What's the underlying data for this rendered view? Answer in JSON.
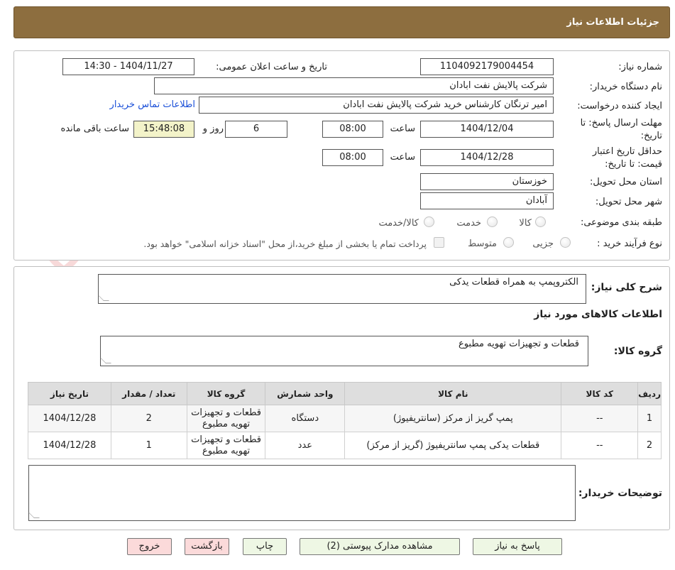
{
  "header": {
    "title": "جزئیات اطلاعات نیاز"
  },
  "form": {
    "need_number_label": "شماره نیاز:",
    "need_number": "1104092179004454",
    "announce_label": "تاریخ و ساعت اعلان عمومی:",
    "announce_value": "1404/11/27 - 14:30",
    "buyer_org_label": "نام دستگاه خریدار:",
    "buyer_org": "شرکت پالایش نفت ابادان",
    "creator_label": "ایجاد کننده درخواست:",
    "creator": "امیر ترنگان کارشناس خرید شرکت پالایش نفت ابادان",
    "contact_link": "اطلاعات تماس خریدار",
    "deadline_label_1": "مهلت ارسال پاسخ: تا",
    "deadline_label_2": "تاریخ:",
    "deadline_date": "1404/12/04",
    "time_label": "ساعت",
    "deadline_time": "08:00",
    "days_value": "6",
    "days_label": "روز و",
    "remaining_time": "15:48:08",
    "remaining_label": "ساعت باقی مانده",
    "validity_label_1": "حداقل تاریخ اعتبار",
    "validity_label_2": "قیمت: تا تاریخ:",
    "validity_date": "1404/12/28",
    "validity_time": "08:00",
    "province_label": "استان محل تحویل:",
    "province": "خوزستان",
    "city_label": "شهر محل تحویل:",
    "city": "آبادان",
    "category_label": "طبقه بندی موضوعی:",
    "category_options": [
      "کالا",
      "خدمت",
      "کالا/خدمت"
    ],
    "process_label": "نوع فرآیند خرید :",
    "process_options": [
      "جزیی",
      "متوسط"
    ],
    "payment_note": "پرداخت تمام یا بخشی از مبلغ خرید،از محل \"اسناد خزانه اسلامی\" خواهد بود."
  },
  "details": {
    "summary_label": "شرح کلی نیاز:",
    "summary": "الکتروپمپ به همراه قطعات یدکی",
    "goods_info_title": "اطلاعات کالاهای مورد نیاز",
    "goods_group_label": "گروه کالا:",
    "goods_group": "قطعات و تجهیزات تهویه مطبوع",
    "table": {
      "headers": [
        "ردیف",
        "کد کالا",
        "نام کالا",
        "واحد شمارش",
        "گروه کالا",
        "تعداد / مقدار",
        "تاریخ نیاز"
      ],
      "rows": [
        {
          "row": "1",
          "code": "--",
          "name": "پمپ گریز از مرکز (سانتریفیوژ)",
          "unit": "دستگاه",
          "group": "قطعات و تجهیزات تهویه مطبوع",
          "qty": "2",
          "date": "1404/12/28"
        },
        {
          "row": "2",
          "code": "--",
          "name": "قطعات یدکی پمپ سانتریفیوژ (گریز از مرکز)",
          "unit": "عدد",
          "group": "قطعات و تجهیزات تهویه مطبوع",
          "qty": "1",
          "date": "1404/12/28"
        }
      ]
    },
    "buyer_notes_label": "توضیحات خریدار:",
    "buyer_notes": ""
  },
  "buttons": {
    "reply": "پاسخ به نیاز",
    "attachments": "مشاهده مدارک پیوستی (2)",
    "print": "چاپ",
    "back": "بازگشت",
    "exit": "خروج"
  },
  "watermark": {
    "text": "AriaTender.neT"
  }
}
